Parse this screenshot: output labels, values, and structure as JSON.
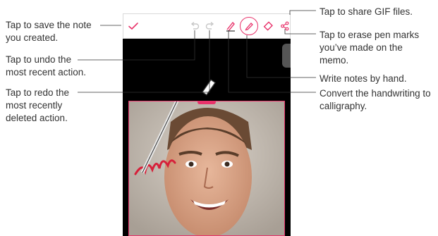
{
  "callouts": {
    "save": "Tap to save the note\nyou created.",
    "undo": "Tap to undo the\nmost recent action.",
    "redo": "Tap to redo the\nmost recently\ndeleted action.",
    "share": "Tap to share GIF files.",
    "erase": "Tap to erase pen marks\nyou’ve made on the\nmemo.",
    "pen": "Write notes by hand.",
    "calligraphy": "Convert the handwriting to\ncalligraphy."
  },
  "toolbar": {
    "icons": [
      "check-icon",
      "undo-icon",
      "redo-icon",
      "calligraphy-icon",
      "pen-icon",
      "eraser-icon",
      "share-icon"
    ]
  },
  "colors": {
    "accent": "#e8336b",
    "callout_line": "#333333",
    "icon_inactive": "#c8c8c8"
  }
}
